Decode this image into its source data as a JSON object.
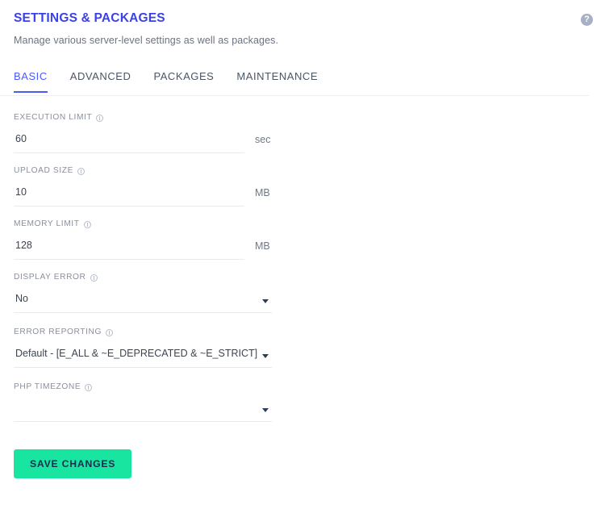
{
  "header": {
    "title": "SETTINGS & PACKAGES",
    "subtitle": "Manage various server-level settings as well as packages.",
    "help_icon": "help-circle-icon",
    "help_glyph": "?",
    "title_color": "#3b41e8"
  },
  "tabs": [
    {
      "label": "BASIC",
      "active": true
    },
    {
      "label": "ADVANCED",
      "active": false
    },
    {
      "label": "PACKAGES",
      "active": false
    },
    {
      "label": "MAINTENANCE",
      "active": false
    }
  ],
  "active_tab_color": "#4a5bf5",
  "fields": {
    "execution_limit": {
      "label": "EXECUTION LIMIT",
      "value": "60",
      "placeholder": "",
      "unit": "sec"
    },
    "upload_size": {
      "label": "UPLOAD SIZE",
      "value": "10",
      "placeholder": "",
      "unit": "MB"
    },
    "memory_limit": {
      "label": "MEMORY LIMIT",
      "value": "128",
      "placeholder": "",
      "unit": "MB"
    },
    "display_error": {
      "label": "DISPLAY ERROR",
      "value": "No"
    },
    "error_reporting": {
      "label": "ERROR REPORTING",
      "value": "Default - [E_ALL & ~E_DEPRECATED & ~E_STRICT]"
    },
    "php_timezone": {
      "label": "PHP TIMEZONE",
      "value": ""
    }
  },
  "actions": {
    "save_label": "SAVE CHANGES",
    "save_color": "#18e6a0"
  }
}
